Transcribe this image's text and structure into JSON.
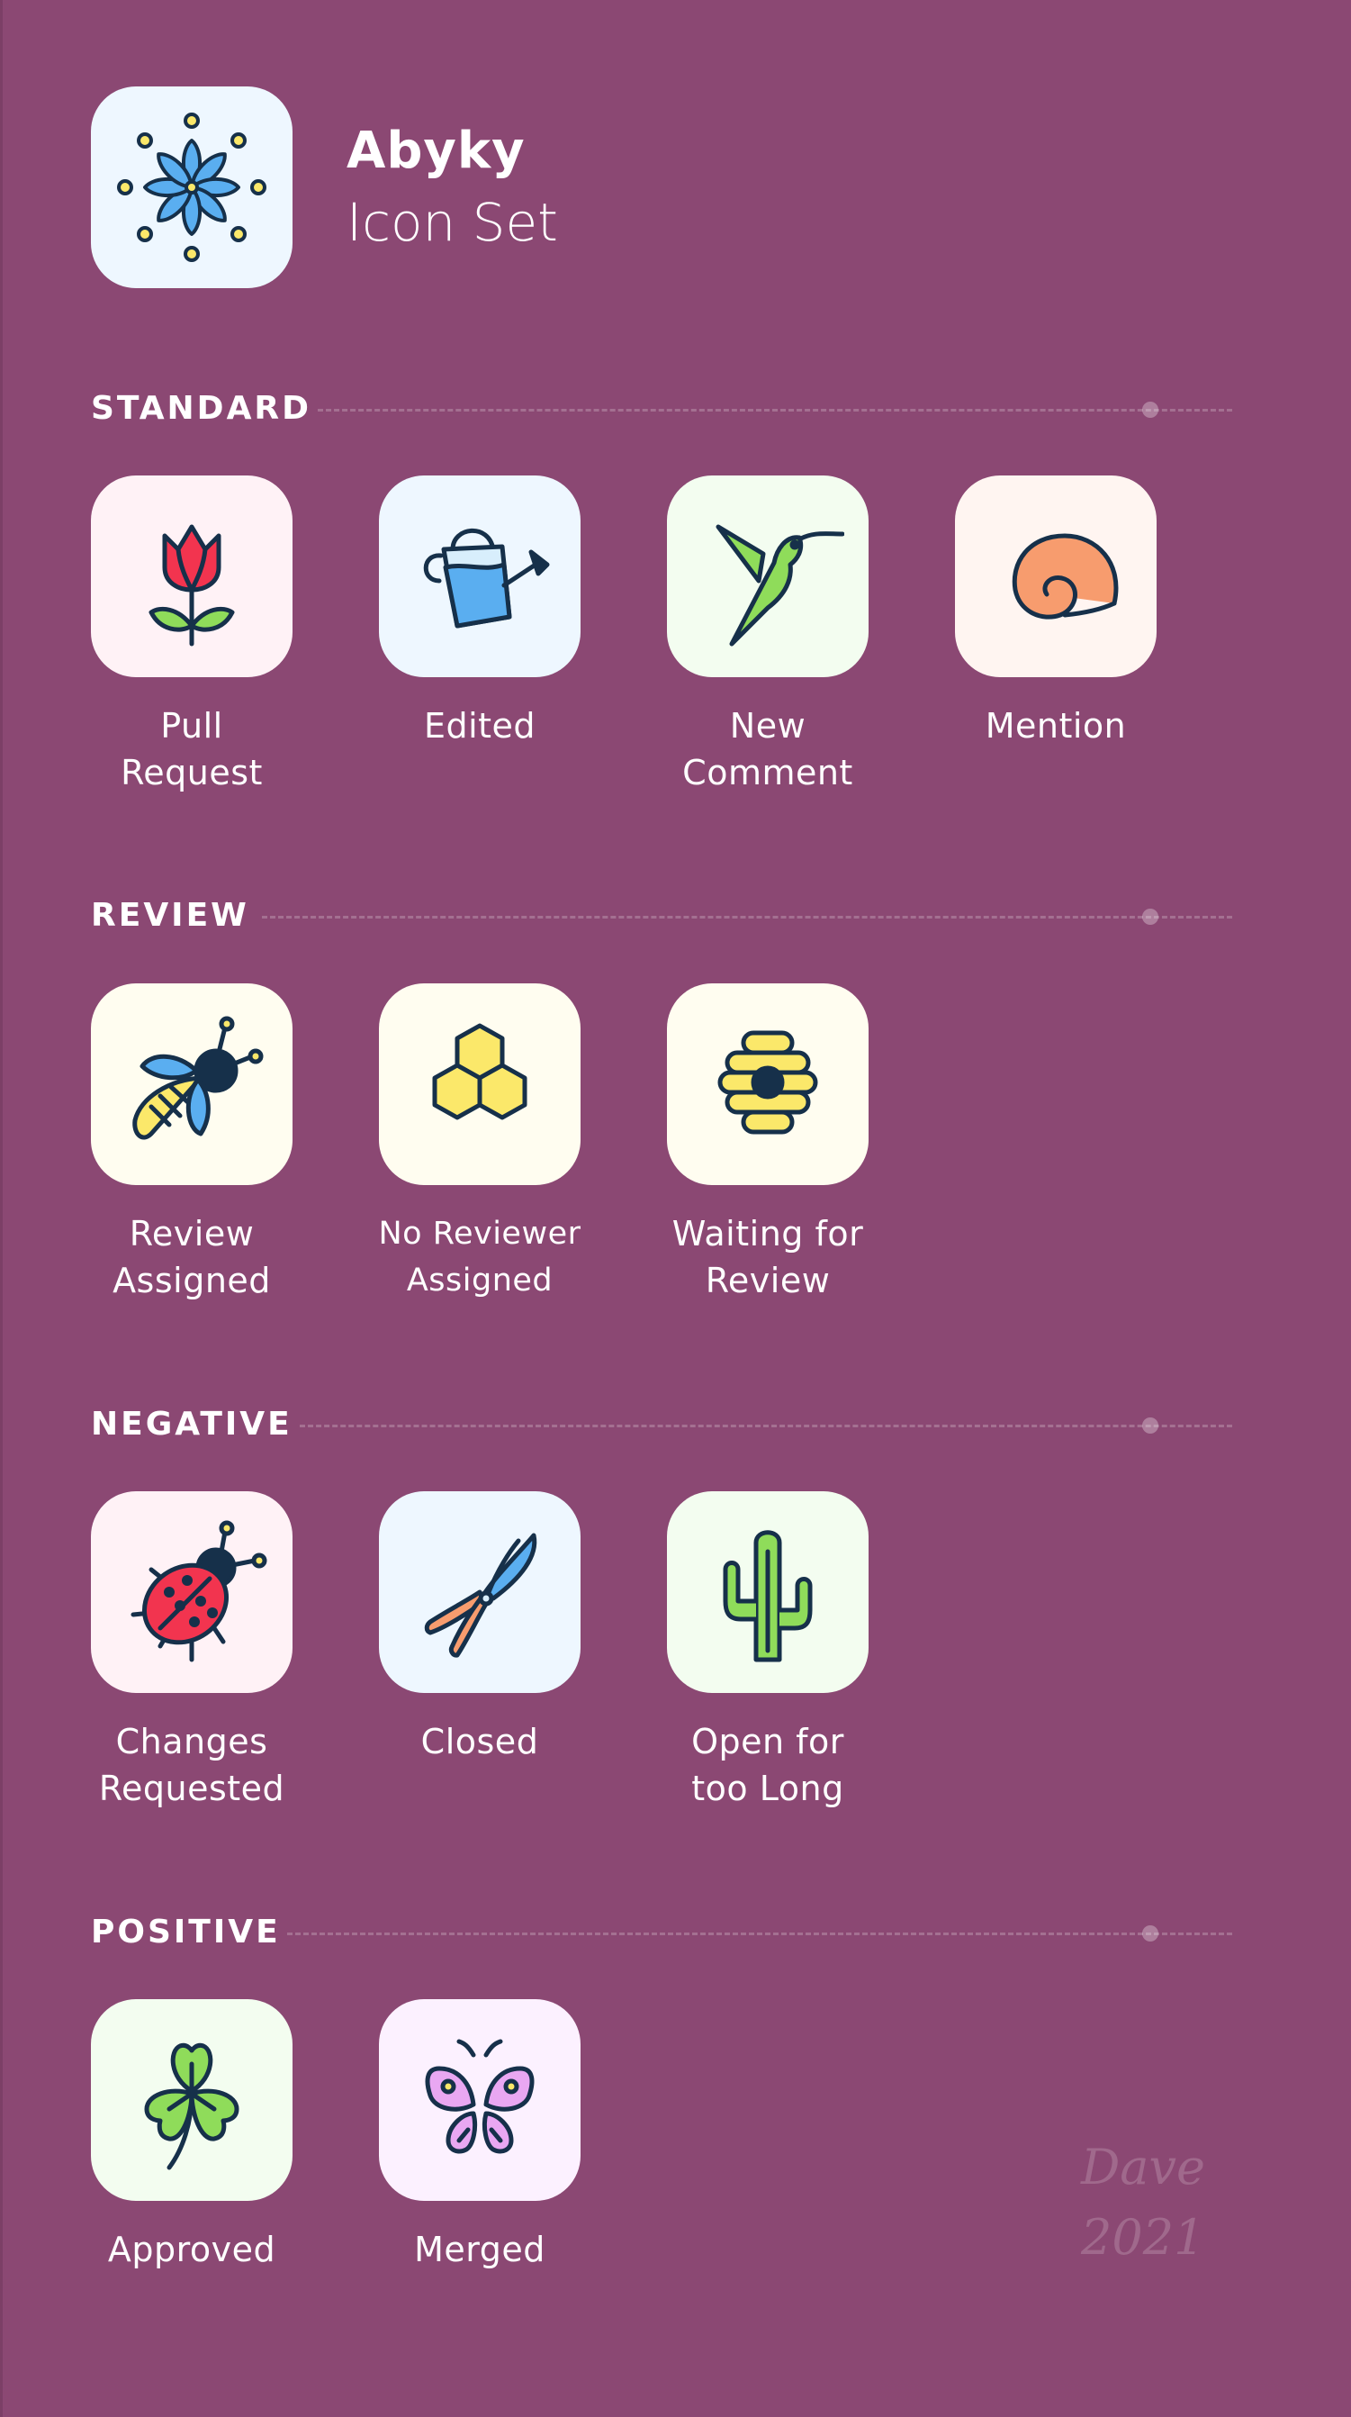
{
  "header": {
    "name": "Abyky",
    "subtitle": "Icon Set"
  },
  "sections": [
    {
      "title": "STANDARD",
      "items": [
        {
          "label_line1": "Pull",
          "label_line2": "Request",
          "icon": "tulip-icon",
          "bg": "#fff2f6"
        },
        {
          "label_line1": "Edited",
          "label_line2": "",
          "icon": "watering-can-icon",
          "bg": "#eef7ff"
        },
        {
          "label_line1": "New",
          "label_line2": "Comment",
          "icon": "hummingbird-icon",
          "bg": "#f3fdf0"
        },
        {
          "label_line1": "Mention",
          "label_line2": "",
          "icon": "snail-shell-icon",
          "bg": "#fff5f1"
        }
      ]
    },
    {
      "title": "REVIEW",
      "items": [
        {
          "label_line1": "Review",
          "label_line2": "Assigned",
          "icon": "bee-icon",
          "bg": "#fffdf0"
        },
        {
          "label_line1": "No Reviewer",
          "label_line2": "Assigned",
          "icon": "honeycomb-icon",
          "bg": "#fffdf0"
        },
        {
          "label_line1": "Waiting for",
          "label_line2": "Review",
          "icon": "beehive-icon",
          "bg": "#fffdf0"
        }
      ]
    },
    {
      "title": "NEGATIVE",
      "items": [
        {
          "label_line1": "Changes",
          "label_line2": "Requested",
          "icon": "ladybug-icon",
          "bg": "#fff2f6"
        },
        {
          "label_line1": "Closed",
          "label_line2": "",
          "icon": "pruning-shears-icon",
          "bg": "#eef7ff"
        },
        {
          "label_line1": "Open for",
          "label_line2": "too Long",
          "icon": "cactus-icon",
          "bg": "#f3fdf0"
        }
      ]
    },
    {
      "title": "POSITIVE",
      "items": [
        {
          "label_line1": "Approved",
          "label_line2": "",
          "icon": "clover-icon",
          "bg": "#f3fdf0"
        },
        {
          "label_line1": "Merged",
          "label_line2": "",
          "icon": "butterfly-icon",
          "bg": "#fcf1ff"
        }
      ]
    }
  ],
  "signature": {
    "line1": "Dave",
    "line2": "2021"
  },
  "colors": {
    "background": "#8b4873",
    "outline": "#16304a",
    "blue": "#5aaef0",
    "red": "#f2344f",
    "green": "#8fdc5a",
    "yellow": "#fbe86a",
    "orange": "#f79c6e",
    "pink": "#e9a7f2"
  }
}
